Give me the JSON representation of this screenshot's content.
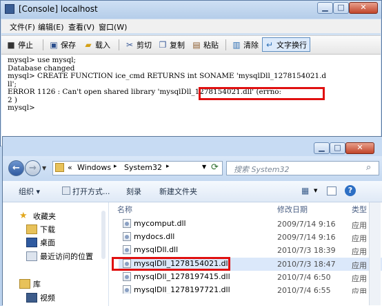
{
  "console": {
    "title": "[Console] localhost",
    "menu": [
      "文件(F)",
      "编辑(E)",
      "查看(V)",
      "窗口(W)"
    ],
    "toolbar": {
      "stop": "停止",
      "save": "保存",
      "load": "载入",
      "cut": "剪切",
      "copy": "复制",
      "paste": "粘贴",
      "clear": "清除",
      "wrap": "文字换行"
    },
    "lines": [
      "mysql> use mysql;",
      "Database changed",
      "mysql> CREATE FUNCTION ice_cmd RETURNS int SONAME 'mysqlDll_1278154021.d",
      "ll';",
      "ERROR 1126 : Can't open shared library 'mysqlDll_1278154021.dll' (errno:",
      "2 )",
      "mysql>"
    ]
  },
  "explorer": {
    "address": {
      "prefix": "«",
      "parts": [
        "Windows",
        "System32"
      ]
    },
    "search_placeholder": "搜索 System32",
    "commands": [
      "组织 ▾",
      "打开方式...",
      "刻录",
      "新建文件夹"
    ],
    "nav": [
      {
        "label": "收藏夹",
        "icon": "star-icon"
      },
      {
        "label": "下载",
        "icon": "download-folder-icon"
      },
      {
        "label": "桌面",
        "icon": "desktop-icon"
      },
      {
        "label": "最近访问的位置",
        "icon": "recent-places-icon"
      },
      {
        "label": "库",
        "icon": "library-icon"
      },
      {
        "label": "视频",
        "icon": "video-library-icon"
      }
    ],
    "columns": {
      "name": "名称",
      "date": "修改日期",
      "type": "类型"
    },
    "files": [
      {
        "name": "mycomput.dll",
        "date": "2009/7/14 9:16",
        "type": "应用"
      },
      {
        "name": "mydocs.dll",
        "date": "2009/7/14 9:16",
        "type": "应用"
      },
      {
        "name": "mysqlDll.dll",
        "date": "2010/7/3 18:39",
        "type": "应用"
      },
      {
        "name": "mysqlDll_1278154021.dll",
        "date": "2010/7/3 18:47",
        "type": "应用"
      },
      {
        "name": "mysqlDll_1278197415.dll",
        "date": "2010/7/4 6:50",
        "type": "应用"
      },
      {
        "name": "mysqlDll_1278197721.dll",
        "date": "2010/7/4 6:55",
        "type": "应用"
      }
    ]
  }
}
